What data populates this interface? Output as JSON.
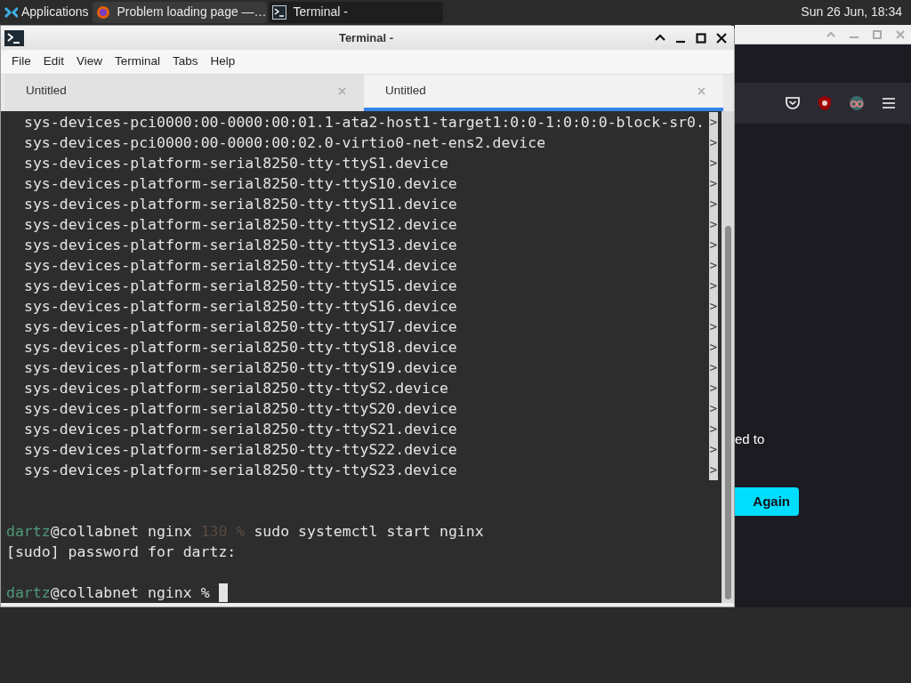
{
  "taskbar": {
    "menu_label": "Applications",
    "tasks": [
      {
        "title": "Problem loading page —…",
        "kind": "browser",
        "selected": true
      },
      {
        "title": "Terminal -",
        "kind": "terminal",
        "selected": false
      }
    ],
    "clock": "Sun 26 Jun, 18:34"
  },
  "browser": {
    "message_fragment": "ed to",
    "button": "Again"
  },
  "terminal": {
    "title": "Terminal -",
    "menu": [
      "File",
      "Edit",
      "View",
      "Terminal",
      "Tabs",
      "Help"
    ],
    "tabs": [
      {
        "label": "Untitled",
        "selected": false
      },
      {
        "label": "Untitled",
        "selected": true
      }
    ],
    "pager_lines": [
      {
        "text": "sys-devices-pci0000:00-0000:00:01.1-ata2-host1-target1:0:0-1:0:0:0-block-sr0.",
        "marker": ">"
      },
      {
        "text": "sys-devices-pci0000:00-0000:00:02.0-virtio0-net-ens2.device",
        "marker": ">"
      },
      {
        "text": "sys-devices-platform-serial8250-tty-ttyS1.device",
        "marker": ">"
      },
      {
        "text": "sys-devices-platform-serial8250-tty-ttyS10.device",
        "marker": ">"
      },
      {
        "text": "sys-devices-platform-serial8250-tty-ttyS11.device",
        "marker": ">"
      },
      {
        "text": "sys-devices-platform-serial8250-tty-ttyS12.device",
        "marker": ">"
      },
      {
        "text": "sys-devices-platform-serial8250-tty-ttyS13.device",
        "marker": ">"
      },
      {
        "text": "sys-devices-platform-serial8250-tty-ttyS14.device",
        "marker": ">"
      },
      {
        "text": "sys-devices-platform-serial8250-tty-ttyS15.device",
        "marker": ">"
      },
      {
        "text": "sys-devices-platform-serial8250-tty-ttyS16.device",
        "marker": ">"
      },
      {
        "text": "sys-devices-platform-serial8250-tty-ttyS17.device",
        "marker": ">"
      },
      {
        "text": "sys-devices-platform-serial8250-tty-ttyS18.device",
        "marker": ">"
      },
      {
        "text": "sys-devices-platform-serial8250-tty-ttyS19.device",
        "marker": ">"
      },
      {
        "text": "sys-devices-platform-serial8250-tty-ttyS2.device",
        "marker": ">"
      },
      {
        "text": "sys-devices-platform-serial8250-tty-ttyS20.device",
        "marker": ">"
      },
      {
        "text": "sys-devices-platform-serial8250-tty-ttyS21.device",
        "marker": ">"
      },
      {
        "text": "sys-devices-platform-serial8250-tty-ttyS22.device",
        "marker": ">"
      },
      {
        "text": "sys-devices-platform-serial8250-tty-ttyS23.device",
        "marker": ">"
      }
    ],
    "lines": [
      {
        "kind": "blank"
      },
      {
        "kind": "blank"
      },
      {
        "kind": "prompt",
        "user": "dartz",
        "host": "@collabnet nginx",
        "status": "130",
        "symbol": "%",
        "command": "sudo systemctl start nginx"
      },
      {
        "kind": "output",
        "text": "[sudo] password for dartz:"
      },
      {
        "kind": "blank"
      },
      {
        "kind": "prompt",
        "user": "dartz",
        "host": "@collabnet nginx",
        "symbol": "%",
        "cursor": true
      }
    ]
  }
}
